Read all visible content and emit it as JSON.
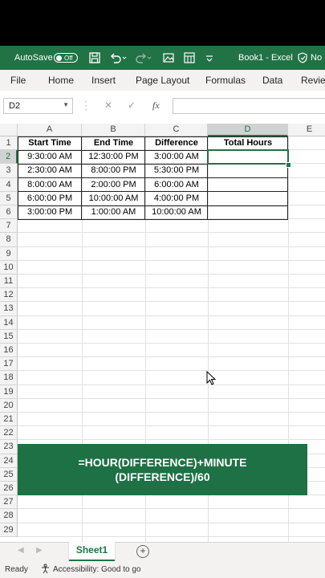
{
  "titlebar": {
    "autosave_label": "AutoSave",
    "autosave_state": "Off",
    "doc_title": "Book1 - Excel",
    "no_label": "No"
  },
  "ribbon": {
    "tabs": [
      "File",
      "Home",
      "Insert",
      "Page Layout",
      "Formulas",
      "Data",
      "Review"
    ]
  },
  "formula_bar": {
    "name_box": "D2",
    "fx": "fx",
    "value": ""
  },
  "sheet": {
    "columns": [
      "A",
      "B",
      "C",
      "D",
      "E"
    ],
    "selected_column": "D",
    "rows": [
      "1",
      "2",
      "3",
      "4",
      "5",
      "6",
      "7",
      "8",
      "9",
      "10",
      "11",
      "12",
      "13",
      "14",
      "15",
      "16",
      "17",
      "18",
      "19",
      "20",
      "21",
      "22",
      "23",
      "24",
      "25",
      "26",
      "27",
      "28",
      "29"
    ],
    "selected_row": "2",
    "headers": [
      "Start Time",
      "End Time",
      "Difference",
      "Total Hours"
    ],
    "data": [
      [
        "9:30:00 AM",
        "12:30:00 PM",
        "3:00:00 AM",
        ""
      ],
      [
        "2:30:00 AM",
        "8:00:00 PM",
        "5:30:00 PM",
        ""
      ],
      [
        "8:00:00 AM",
        "2:00:00 PM",
        "6:00:00 AM",
        ""
      ],
      [
        "6:00:00 PM",
        "10:00:00 AM",
        "4:00:00 PM",
        ""
      ],
      [
        "3:00:00 PM",
        "1:00:00 AM",
        "10:00:00 AM",
        ""
      ]
    ]
  },
  "banner": {
    "formula": "=HOUR(DIFFERENCE)+MINUTE (DIFFERENCE)/60"
  },
  "sheet_tabs": {
    "active": "Sheet1"
  },
  "status": {
    "ready": "Ready",
    "accessibility": "Accessibility: Good to go"
  },
  "colors": {
    "excel_green": "#217346",
    "banner_green": "#1e7145"
  }
}
